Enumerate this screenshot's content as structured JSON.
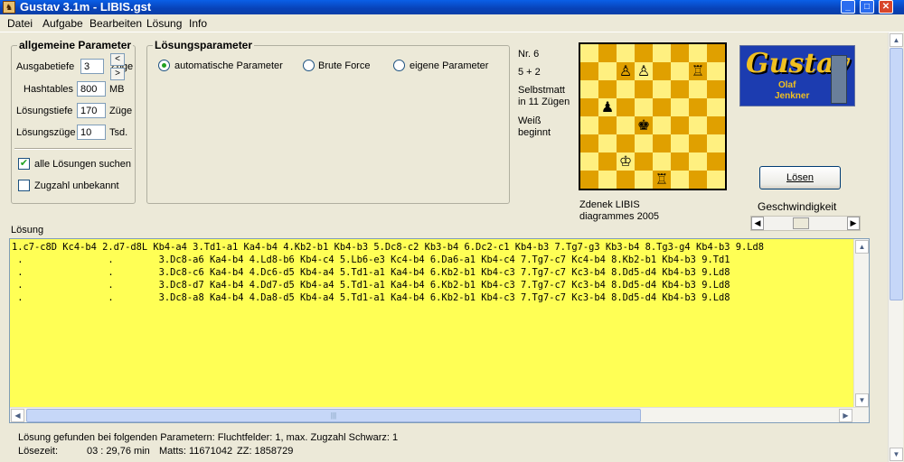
{
  "window": {
    "title": "Gustav 3.1m - LIBIS.gst"
  },
  "menu": [
    "Datei",
    "Aufgabe",
    "Bearbeiten",
    "Lösung",
    "Info"
  ],
  "general_params": {
    "title": "allgemeine Parameter",
    "ausgabetiefe_label": "Ausgabetiefe",
    "ausgabetiefe_value": "3",
    "ausgabetiefe_unit": "Züge",
    "hashtables_label": "Hashtables",
    "hashtables_value": "800",
    "hashtables_unit": "MB",
    "loesungstiefe_label": "Lösungstiefe",
    "loesungstiefe_value": "170",
    "loesungstiefe_unit": "Züge",
    "loesungszuege_label": "Lösungszüge",
    "loesungszuege_value": "10",
    "loesungszuege_unit": "Tsd.",
    "all_solutions_label": "alle Lösungen suchen",
    "all_solutions_checked": true,
    "unknown_moves_label": "Zugzahl unbekannt",
    "unknown_moves_checked": false,
    "spin_left": "<",
    "spin_right": ">"
  },
  "solution_params": {
    "title": "Lösungsparameter",
    "options": [
      "automatische Parameter",
      "Brute Force",
      "eigene Parameter"
    ],
    "selected": 0
  },
  "problem": {
    "number": "Nr. 6",
    "material": "5 + 2",
    "stipulation_1": "Selbstmatt",
    "stipulation_2": "in 11 Zügen",
    "color_1": "Weiß",
    "color_2": "beginnt",
    "author": "Zdenek LIBIS",
    "source": "diagrammes 2005"
  },
  "board": {
    "rows": [
      [
        "",
        "",
        "",
        "",
        "",
        "",
        "",
        ""
      ],
      [
        "",
        "",
        "♙",
        "♙",
        "",
        "",
        "♖",
        ""
      ],
      [
        "",
        "",
        "",
        "",
        "",
        "",
        "",
        ""
      ],
      [
        "",
        "♟",
        "",
        "",
        "",
        "",
        "",
        ""
      ],
      [
        "",
        "",
        "",
        "♚",
        "",
        "",
        "",
        ""
      ],
      [
        "",
        "",
        "",
        "",
        "",
        "",
        "",
        ""
      ],
      [
        "",
        "",
        "♔",
        "",
        "",
        "",
        "",
        ""
      ],
      [
        "",
        "",
        "",
        "",
        "♖",
        "",
        "",
        ""
      ]
    ]
  },
  "logo": {
    "name": "Gustav",
    "author_first": "Olaf",
    "author_last": "Jenkner"
  },
  "solve_button": "Lösen",
  "speed_label": "Geschwindigkeit",
  "speed_value": 0.43,
  "solution": {
    "label": "Lösung",
    "lines": [
      "1.c7-c8D Kc4-b4 2.d7-d8L Kb4-a4 3.Td1-a1 Ka4-b4 4.Kb2-b1 Kb4-b3 5.Dc8-c2 Kb3-b4 6.Dc2-c1 Kb4-b3 7.Tg7-g3 Kb3-b4 8.Tg3-g4 Kb4-b3 9.Ld8",
      " .               .        3.Dc8-a6 Ka4-b4 4.Ld8-b6 Kb4-c4 5.Lb6-e3 Kc4-b4 6.Da6-a1 Kb4-c4 7.Tg7-c7 Kc4-b4 8.Kb2-b1 Kb4-b3 9.Td1",
      " .               .        3.Dc8-c6 Ka4-b4 4.Dc6-d5 Kb4-a4 5.Td1-a1 Ka4-b4 6.Kb2-b1 Kb4-c3 7.Tg7-c7 Kc3-b4 8.Dd5-d4 Kb4-b3 9.Ld8",
      " .               .        3.Dc8-d7 Ka4-b4 4.Dd7-d5 Kb4-a4 5.Td1-a1 Ka4-b4 6.Kb2-b1 Kb4-c3 7.Tg7-c7 Kc3-b4 8.Dd5-d4 Kb4-b3 9.Ld8",
      " .               .        3.Dc8-a8 Ka4-b4 4.Da8-d5 Kb4-a4 5.Td1-a1 Ka4-b4 6.Kb2-b1 Kb4-c3 7.Tg7-c7 Kc3-b4 8.Dd5-d4 Kb4-b3 9.Ld8"
    ]
  },
  "status": {
    "found_text": "Lösung gefunden bei folgenden Parametern: Fluchtfelder: 1, max. Zugzahl Schwarz: 1",
    "time_label": "Lösezeit:",
    "time_value": "03 : 29,76 min",
    "matts": "Matts: 11671042",
    "zz": "ZZ: 1858729"
  },
  "colors": {
    "solution_bg": "#FFFF55",
    "board_light": "#FFF080",
    "board_dark": "#E0A000",
    "titlebar": "#0842B8"
  }
}
